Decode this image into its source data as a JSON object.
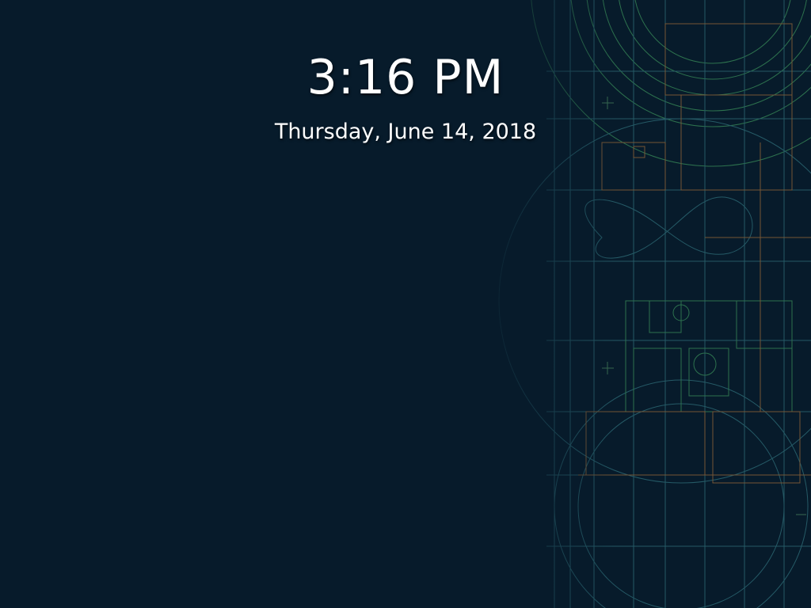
{
  "lockscreen": {
    "time": "3:16 PM",
    "date": "Thursday, June 14, 2018"
  },
  "theme": {
    "background": "#071b2b",
    "text": "#ffffff",
    "line_green": "#3a8f5a",
    "line_orange": "#9a6a3a",
    "line_teal": "#2f6f7a"
  }
}
